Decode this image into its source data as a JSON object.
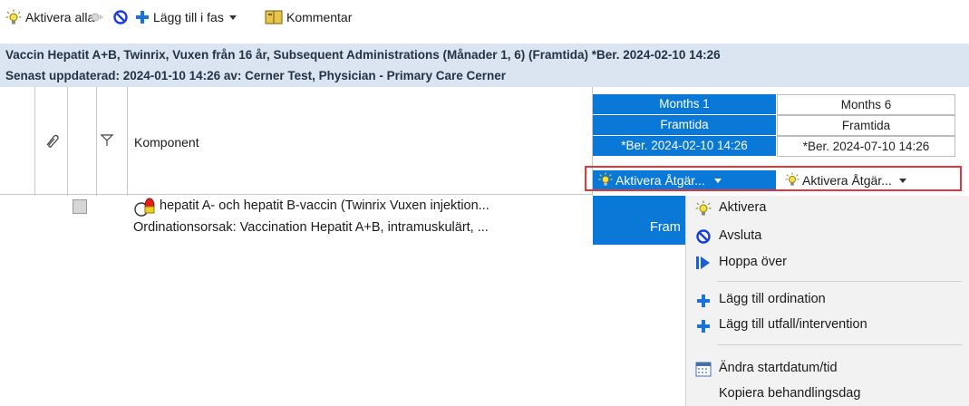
{
  "toolbar": {
    "activate_all": "Aktivera alla",
    "add_in_phase": "Lägg till i fas",
    "comment": "Kommentar"
  },
  "info": {
    "line1": "Vaccin Hepatit A+B, Twinrix, Vuxen från 16 år, Subsequent Administrations (Månader 1, 6) (Framtida) *Ber. 2024-02-10 14:26",
    "line2": "Senast uppdaterad: 2024-01-10 14:26    av: Cerner Test, Physician - Primary Care Cerner"
  },
  "grid": {
    "component_header": "Komponent",
    "columns": [
      {
        "period": "Months 1",
        "status": "Framtida",
        "date": "*Ber. 2024-02-10 14:26",
        "action": "Aktivera  Åtgär...",
        "selected": true
      },
      {
        "period": "Months 6",
        "status": "Framtida",
        "date": "*Ber. 2024-07-10 14:26",
        "action": "Aktivera  Åtgär...",
        "selected": false
      }
    ],
    "row": {
      "drug": "hepatit A- och hepatit B-vaccin (Twinrix Vuxen injektion...",
      "reason": "Ordinationsorsak: Vaccination Hepatit A+B, intramuskulärt, ...",
      "cell_status": "Fram"
    }
  },
  "menu": {
    "items": [
      {
        "label": "Aktivera",
        "icon": "bulb-icon"
      },
      {
        "label": "Avsluta",
        "icon": "stop-icon"
      },
      {
        "label": "Hoppa över",
        "icon": "skip-icon"
      },
      {
        "label": "Lägg till ordination",
        "icon": "plus-icon"
      },
      {
        "label": "Lägg till utfall/intervention",
        "icon": "plus-icon"
      },
      {
        "label": "Ändra startdatum/tid",
        "icon": "calendar-icon"
      },
      {
        "label": "Kopiera behandlingsdag",
        "icon": ""
      }
    ]
  },
  "colors": {
    "selected": "#0a78d7",
    "highlight_box": "#e0383a",
    "header_bg": "#dbe5f1",
    "menu_bg": "#f2f2f2"
  }
}
